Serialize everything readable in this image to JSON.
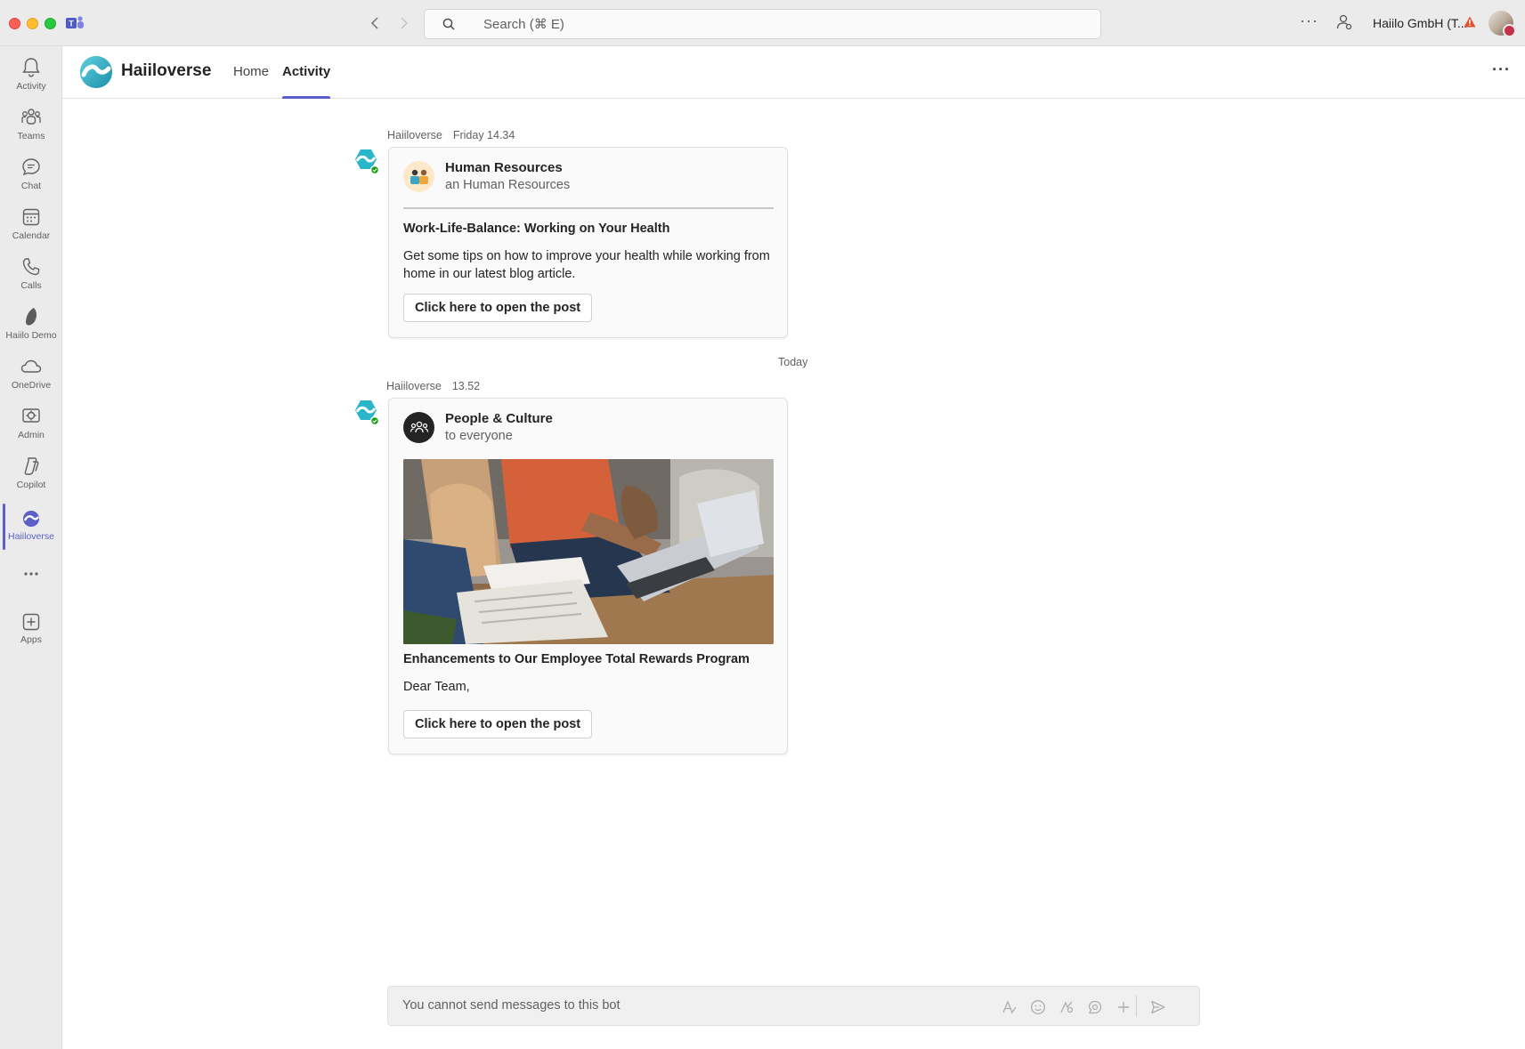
{
  "titlebar": {
    "search_placeholder": "Search (⌘ E)",
    "org_name": "Haiilo GmbH (T..."
  },
  "rail": {
    "items": [
      {
        "label": "Activity",
        "icon": "bell-icon"
      },
      {
        "label": "Teams",
        "icon": "teams-icon"
      },
      {
        "label": "Chat",
        "icon": "chat-icon"
      },
      {
        "label": "Calendar",
        "icon": "calendar-icon"
      },
      {
        "label": "Calls",
        "icon": "phone-icon"
      },
      {
        "label": "Haiilo Demo",
        "icon": "haiilo-demo-icon"
      },
      {
        "label": "OneDrive",
        "icon": "cloud-icon"
      },
      {
        "label": "Admin",
        "icon": "admin-icon"
      },
      {
        "label": "Copilot",
        "icon": "copilot-icon"
      },
      {
        "label": "Haiiloverse",
        "icon": "haiiloverse-icon"
      },
      {
        "label": "Apps",
        "icon": "add-app-icon"
      }
    ],
    "active": "Haiiloverse"
  },
  "app": {
    "name": "Haiiloverse",
    "tabs": [
      {
        "label": "Home"
      },
      {
        "label": "Activity"
      }
    ],
    "active_tab": "Activity"
  },
  "messages": [
    {
      "author": "Haiiloverse",
      "time": "Friday 14.34",
      "sender_name": "Human Resources",
      "sender_sub": "an Human Resources",
      "title": "Work-Life-Balance: Working on Your Health",
      "body": "Get some tips on how to improve your health while working from home in our latest blog article.",
      "button": "Click here to open the post"
    },
    {
      "author": "Haiiloverse",
      "time": "13.52",
      "sender_name": "People & Culture",
      "sender_sub": "to everyone",
      "title": "Enhancements to Our Employee Total Rewards Program",
      "body": "Dear Team,",
      "button": "Click here to open the post"
    }
  ],
  "day_separator": "Today",
  "compose": {
    "placeholder": "You cannot send messages to this bot"
  },
  "colors": {
    "accent": "#5b5fc7",
    "brand_teal": "#2ab5c8",
    "presence_green": "#13a10e"
  }
}
